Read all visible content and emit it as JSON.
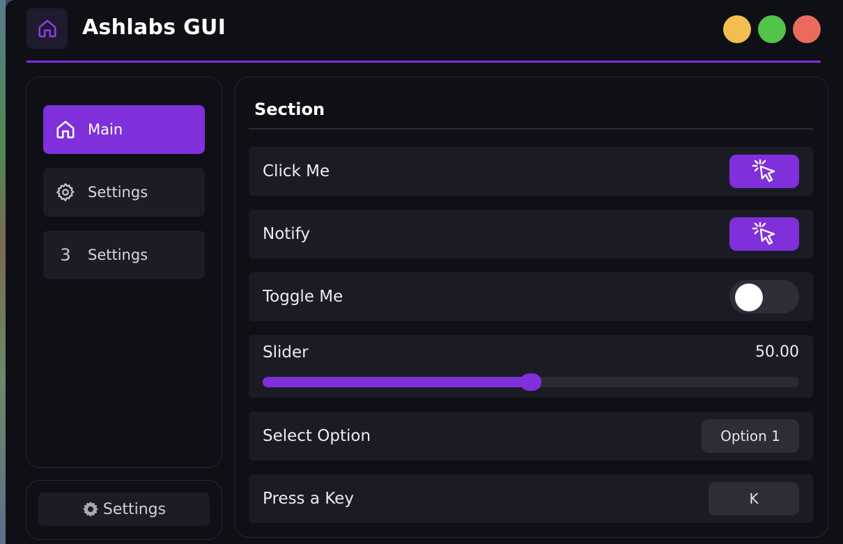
{
  "app": {
    "title": "Ashlabs GUI",
    "icon": "home-icon",
    "accent_color": "#8030da"
  },
  "window_controls": [
    {
      "name": "minimize",
      "color": "#f3be4f"
    },
    {
      "name": "maximize",
      "color": "#52c34b"
    },
    {
      "name": "close",
      "color": "#ea6a5e"
    }
  ],
  "sidebar": {
    "items": [
      {
        "label": "Main",
        "icon": "home-icon",
        "active": true
      },
      {
        "label": "Settings",
        "icon": "gear-icon",
        "active": false
      },
      {
        "label": "Settings",
        "icon_text": "3",
        "active": false
      }
    ],
    "footer": {
      "label": "Settings",
      "icon": "gear-icon"
    }
  },
  "main": {
    "section_title": "Section",
    "rows": {
      "click_me": {
        "label": "Click Me",
        "icon": "click-cursor-icon"
      },
      "notify": {
        "label": "Notify",
        "icon": "click-cursor-icon"
      },
      "toggle": {
        "label": "Toggle Me",
        "state": false
      },
      "slider": {
        "label": "Slider",
        "value_text": "50.00",
        "fraction": 0.5
      },
      "select": {
        "label": "Select Option",
        "value": "Option 1"
      },
      "keybind": {
        "label": "Press a Key",
        "value": "K"
      }
    }
  }
}
